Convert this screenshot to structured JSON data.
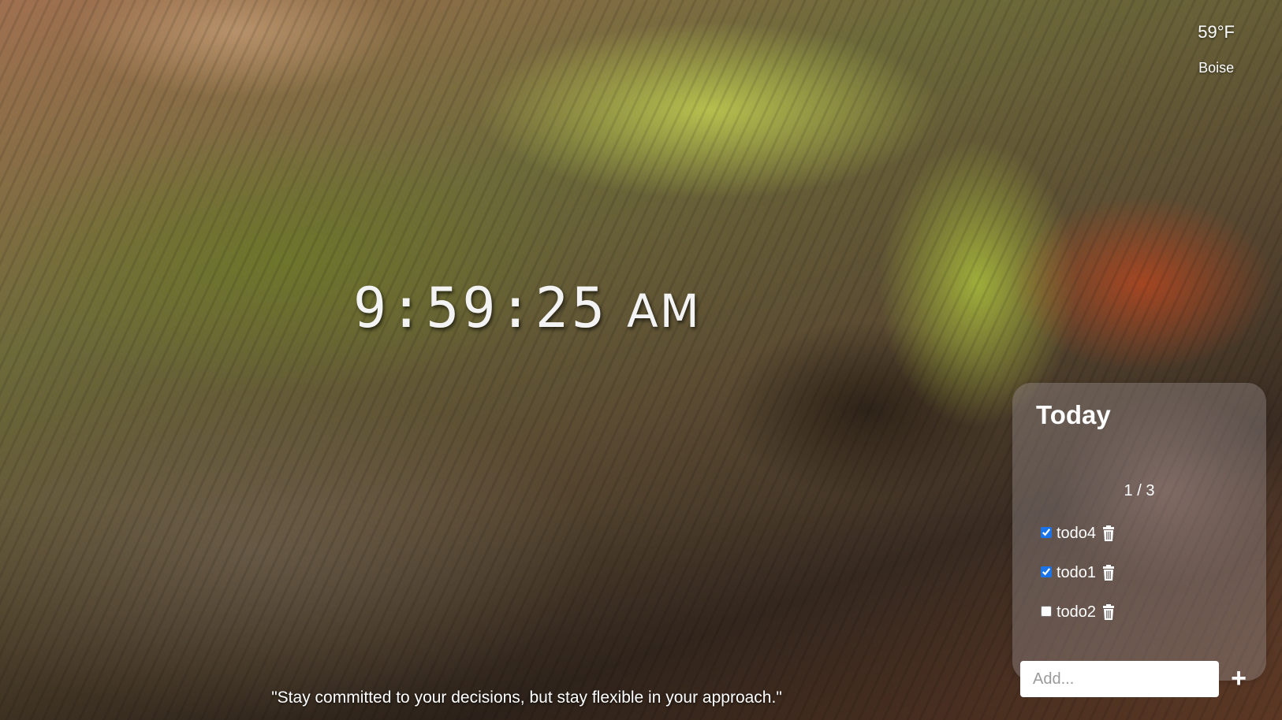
{
  "weather": {
    "temperature": "59°F",
    "city": "Boise"
  },
  "clock": {
    "time": "9:59:25",
    "period": "AM"
  },
  "quote": "\"Stay committed to your decisions, but stay flexible in your approach.\"",
  "todo": {
    "title": "Today",
    "count": "1 / 3",
    "items": [
      {
        "label": "todo4",
        "checked": true
      },
      {
        "label": "todo1",
        "checked": true
      },
      {
        "label": "todo2",
        "checked": false
      }
    ],
    "add_placeholder": "Add...",
    "add_button": "+"
  },
  "icons": {
    "delete": "trash-icon"
  },
  "colors": {
    "text": "#ffffff",
    "panel": "rgba(150,140,140,0.42)",
    "checkbox_accent": "#1a73e8"
  }
}
